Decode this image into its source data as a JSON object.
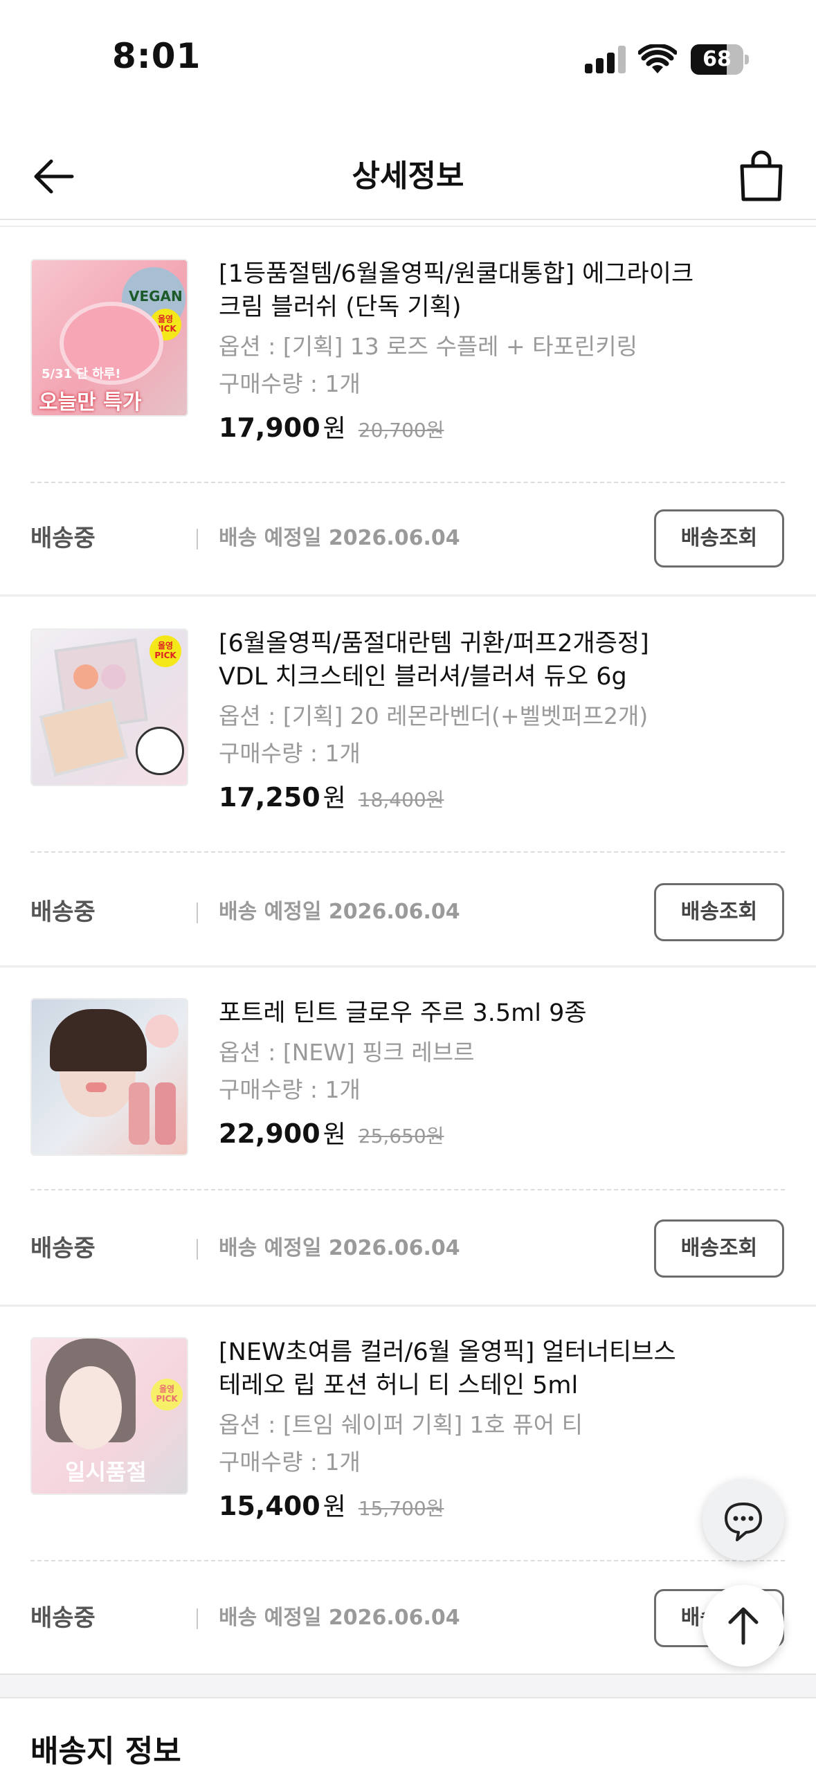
{
  "status_bar": {
    "time": "8:01",
    "battery": "68",
    "battery_level": 0.68
  },
  "header": {
    "title": "상세정보",
    "back_icon": "arrow-left-icon",
    "cart_icon": "shopping-bag-icon"
  },
  "items": [
    {
      "name_line1": "[1등품절템/6월올영픽/원쿨대통합] 에그라이크",
      "name_line2": "크림 블러쉬 (단독 기획)",
      "option": "옵션 : [기획] 13 로즈 수플레 + 타포린키링",
      "qty": "구매수량 : 1개",
      "price": "17,900",
      "won": "원",
      "original_price": "20,700원",
      "thumb_badge1": "5/31 단 하루!",
      "thumb_badge2": "오늘만 특가",
      "thumb_badge3": "VEGAN",
      "status": "배송중",
      "delivery_date": "배송 예정일 2026.06.04",
      "track_label": "배송조회"
    },
    {
      "name_line1": "[6월올영픽/품절대란템 귀환/퍼프2개증정]",
      "name_line2": "VDL 치크스테인 블러셔/블러셔 듀오 6g",
      "option": "옵션 : [기획] 20 레몬라벤더(+벨벳퍼프2개)",
      "qty": "구매수량 : 1개",
      "price": "17,250",
      "won": "원",
      "original_price": "18,400원",
      "status": "배송중",
      "delivery_date": "배송 예정일 2026.06.04",
      "track_label": "배송조회"
    },
    {
      "name_line1": "포트레 틴트 글로우 주르 3.5ml 9종",
      "name_line2": "",
      "option": "옵션 : [NEW] 핑크 레브르",
      "qty": "구매수량 : 1개",
      "price": "22,900",
      "won": "원",
      "original_price": "25,650원",
      "status": "배송중",
      "delivery_date": "배송 예정일 2026.06.04",
      "track_label": "배송조회"
    },
    {
      "name_line1": "[NEW초여름 컬러/6월 올영픽] 얼터너티브스",
      "name_line2": "테레오 립 포션 허니 티 스테인 5ml",
      "option": "옵션 : [트임 쉐이퍼 기획] 1호 퓨어 티",
      "qty": "구매수량 : 1개",
      "price": "15,400",
      "won": "원",
      "original_price": "15,700원",
      "thumb_overlay": "일시품절",
      "status": "배송중",
      "delivery_date": "배송 예정일 2026.06.04",
      "track_label": "배송조회"
    }
  ],
  "badges": {
    "olive_pick": "올영 PICK"
  },
  "floating": {
    "chat_icon": "chat-bubble-icon",
    "top_icon": "arrow-up-icon"
  },
  "shipping_section": {
    "title": "배송지 정보"
  }
}
